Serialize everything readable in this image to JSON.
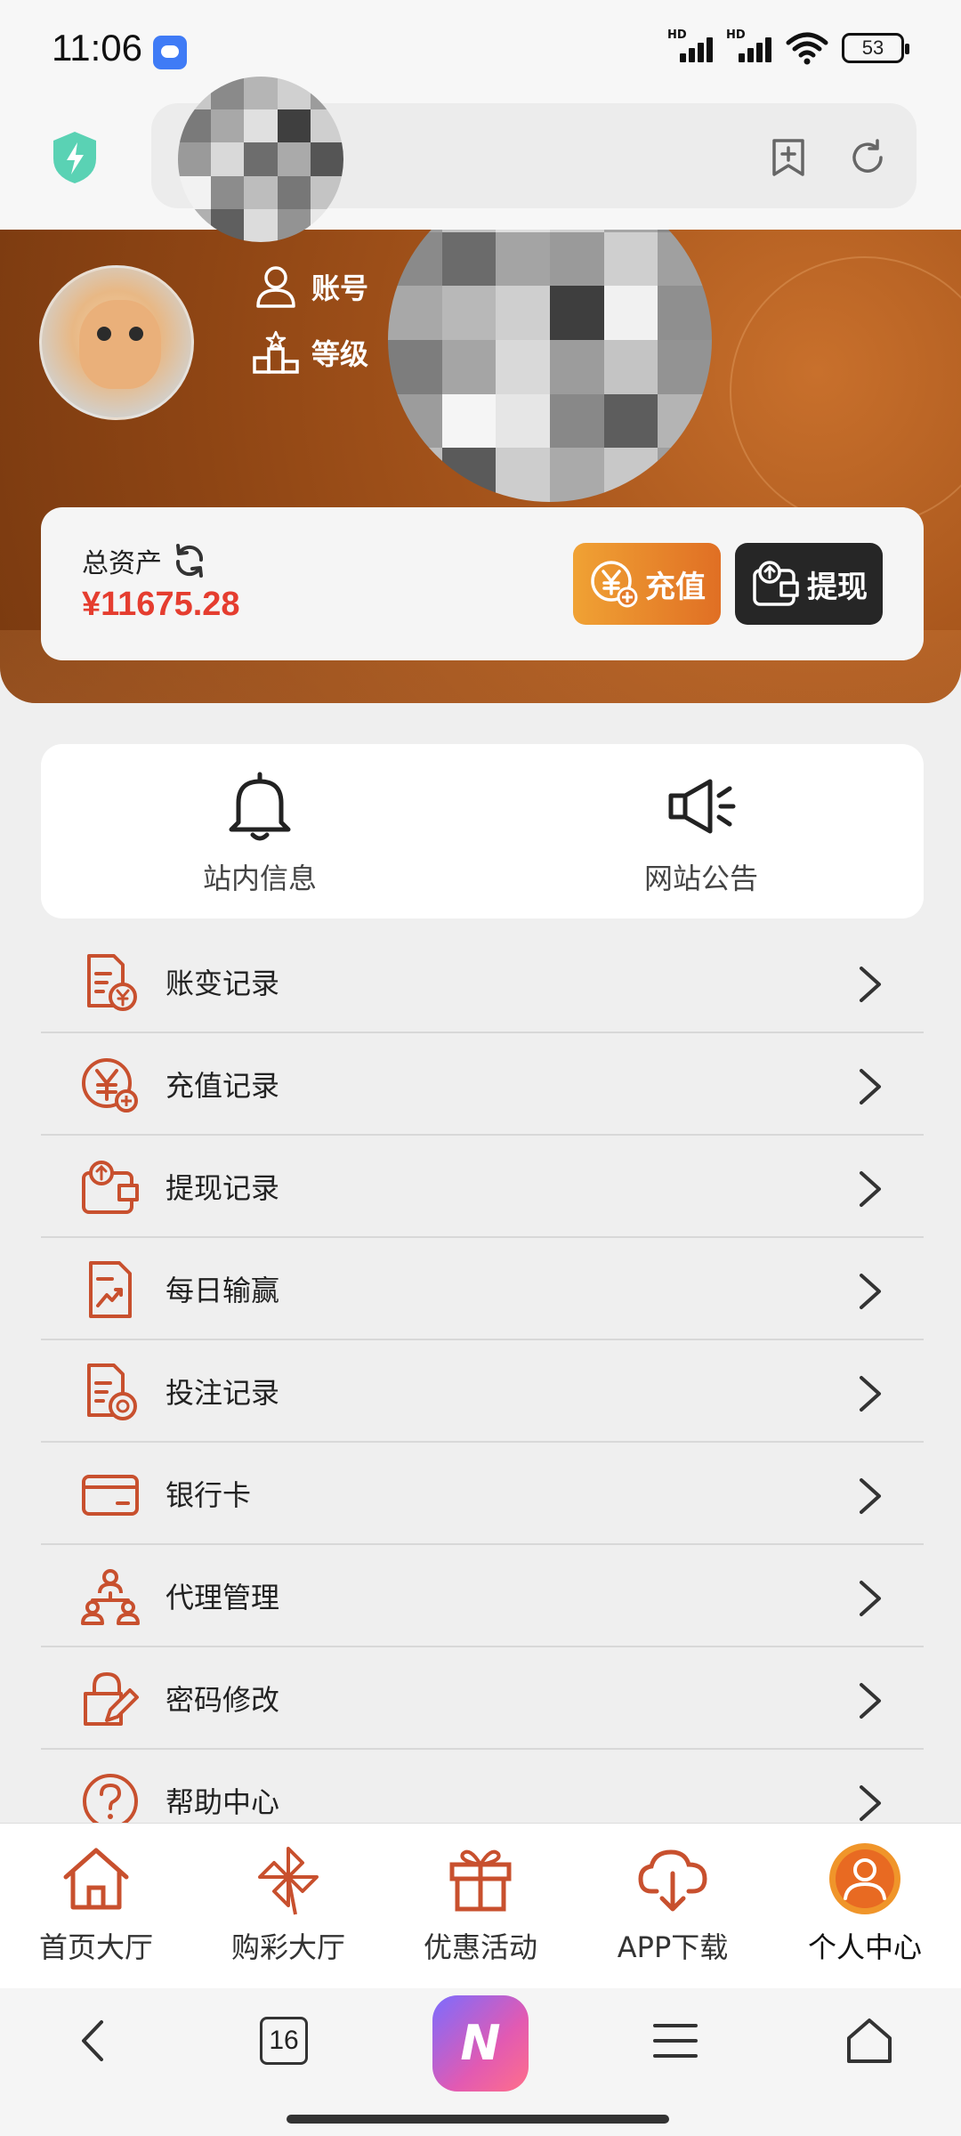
{
  "status_bar": {
    "time": "11:06",
    "battery": "53",
    "signal_label": "HD"
  },
  "profile": {
    "account_label": "账号",
    "level_label": "等级"
  },
  "assets": {
    "label": "总资产",
    "value": "¥11675.28",
    "recharge_label": "充值",
    "withdraw_label": "提现"
  },
  "messages": [
    {
      "label": "站内信息",
      "icon": "bell-icon"
    },
    {
      "label": "网站公告",
      "icon": "megaphone-icon"
    }
  ],
  "menu": [
    {
      "label": "账变记录",
      "icon": "account-change-icon"
    },
    {
      "label": "充值记录",
      "icon": "recharge-record-icon"
    },
    {
      "label": "提现记录",
      "icon": "withdraw-record-icon"
    },
    {
      "label": "每日输赢",
      "icon": "daily-chart-icon"
    },
    {
      "label": "投注记录",
      "icon": "bet-record-icon"
    },
    {
      "label": "银行卡",
      "icon": "bank-card-icon"
    },
    {
      "label": "代理管理",
      "icon": "agent-icon"
    },
    {
      "label": "密码修改",
      "icon": "password-edit-icon"
    },
    {
      "label": "帮助中心",
      "icon": "help-icon"
    }
  ],
  "tabs": [
    {
      "label": "首页大厅",
      "icon": "home-icon"
    },
    {
      "label": "购彩大厅",
      "icon": "pinwheel-icon"
    },
    {
      "label": "优惠活动",
      "icon": "gift-icon"
    },
    {
      "label": "APP下载",
      "icon": "cloud-download-icon"
    },
    {
      "label": "个人中心",
      "icon": "user-circle-icon",
      "active": true
    }
  ],
  "system_nav": {
    "tab_count": "16"
  },
  "colors": {
    "accent": "#c8502e",
    "brand_orange": "#e06f24",
    "amount_red": "#e53d2f",
    "header_brown": "#8e4514"
  }
}
